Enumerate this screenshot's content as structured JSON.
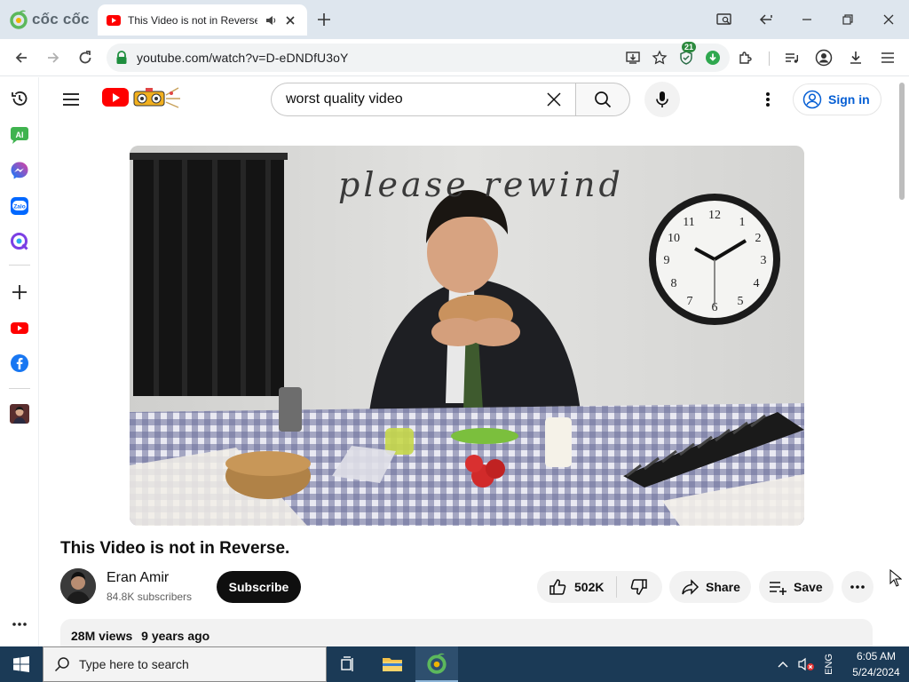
{
  "browser": {
    "brand_name": "cốc cốc",
    "tab": {
      "title": "This Video is not in Reverse."
    },
    "url": "youtube.com/watch?v=D-eDNDfU3oY",
    "extension_badge": "21"
  },
  "youtube": {
    "search": {
      "query": "worst quality video"
    },
    "sign_in_label": "Sign in",
    "video": {
      "overlay_text": "please rewind",
      "title": "This Video is not in Reverse."
    },
    "channel": {
      "name": "Eran Amir",
      "subscribers": "84.8K subscribers"
    },
    "subscribe_label": "Subscribe",
    "actions": {
      "like_count": "502K",
      "share_label": "Share",
      "save_label": "Save"
    },
    "description": {
      "views": "28M views",
      "age": "9 years ago"
    }
  },
  "taskbar": {
    "search_placeholder": "Type here to search",
    "language": "ENG",
    "time": "6:05 AM",
    "date": "5/24/2024"
  },
  "colors": {
    "youtube_red": "#ff0000",
    "link_blue": "#065fd4",
    "taskbar": "#1b3a56",
    "tab_strip": "#dee6ee"
  },
  "icons": [
    "coccoc-logo-icon",
    "youtube-favicon-icon",
    "speaker-icon",
    "close-icon",
    "plus-icon",
    "screen-search-icon",
    "minimize-icon",
    "maximize-icon",
    "back-icon",
    "forward-icon",
    "reload-icon",
    "lock-icon",
    "install-icon",
    "star-icon",
    "shield-icon",
    "download-arrow-icon",
    "puzzle-icon",
    "playlist-icon",
    "profile-icon",
    "download-icon",
    "menu-icon",
    "history-icon",
    "ai-icon",
    "messenger-icon",
    "zalo-icon",
    "q-icon",
    "youtube-icon",
    "facebook-icon",
    "search-icon",
    "mic-icon",
    "kebab-icon",
    "user-circle-icon",
    "thumb-up-icon",
    "thumb-down-icon",
    "share-icon",
    "save-icon",
    "windows-icon",
    "task-view-icon",
    "folder-icon",
    "chevron-up-icon",
    "volume-muted-icon"
  ]
}
